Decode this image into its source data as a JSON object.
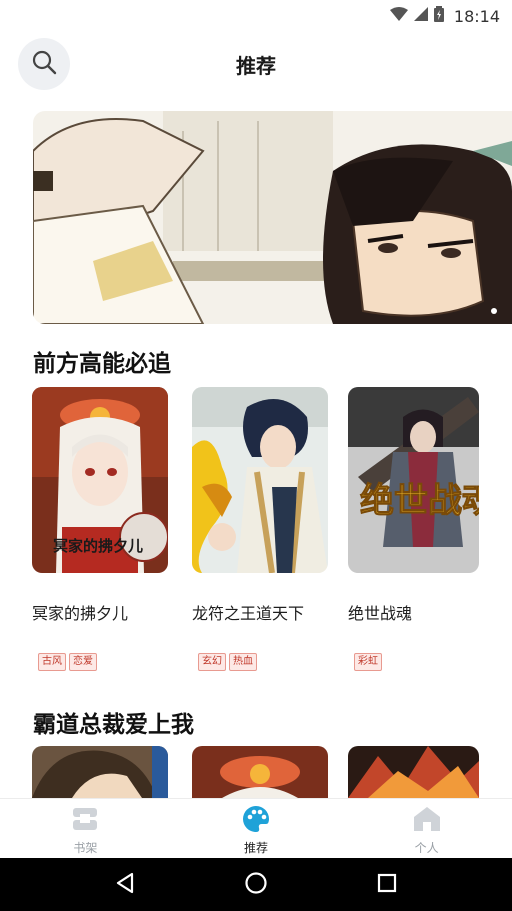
{
  "status_bar": {
    "time": "18:14"
  },
  "header": {
    "title": "推荐",
    "search_icon": "search-icon"
  },
  "banner": {
    "indicator_count": 1
  },
  "sections": [
    {
      "title": "前方高能必追",
      "books": [
        {
          "name": "冥家的拂夕儿",
          "tags": [
            "古风",
            "恋爱"
          ],
          "cover_text": "冥家的拂夕儿"
        },
        {
          "name": "龙符之王道天下",
          "tags": [
            "玄幻",
            "热血"
          ]
        },
        {
          "name": "绝世战魂",
          "tags": [
            "彩虹"
          ],
          "cover_text": "绝世战魂"
        }
      ]
    },
    {
      "title": "霸道总裁爱上我"
    }
  ],
  "tabbar": {
    "items": [
      {
        "label": "书架",
        "icon": "bookshelf-icon",
        "active": false
      },
      {
        "label": "推荐",
        "icon": "palette-icon",
        "active": true
      },
      {
        "label": "个人",
        "icon": "home-icon",
        "active": false
      }
    ]
  },
  "colors": {
    "accent": "#1fa2d8",
    "tag_text": "#c0392b",
    "tag_bg": "#fde9e6"
  }
}
